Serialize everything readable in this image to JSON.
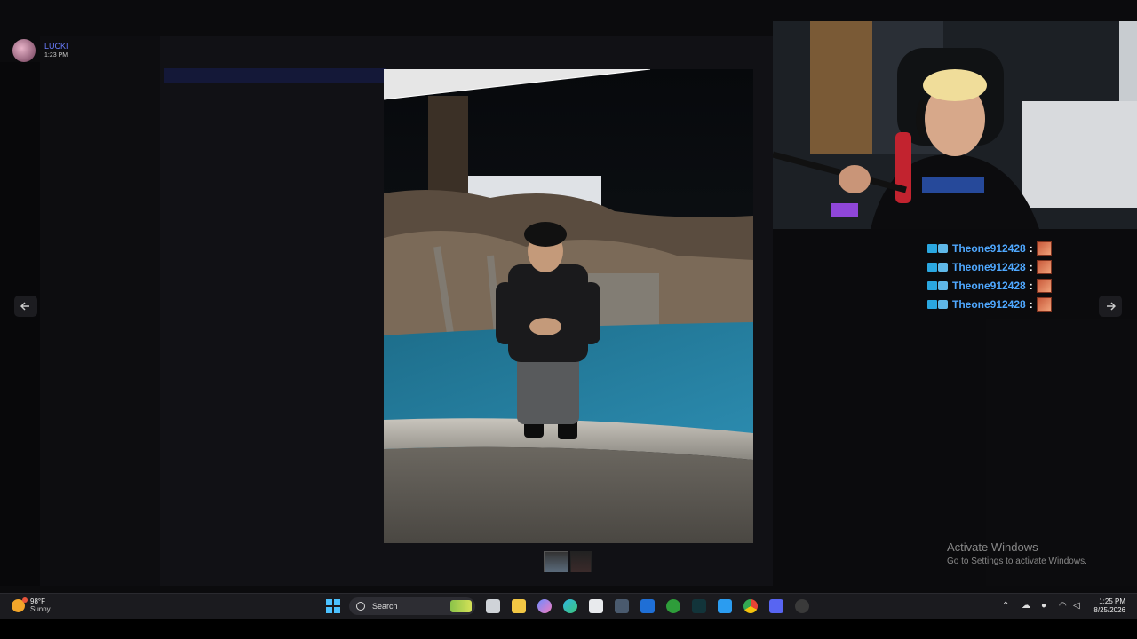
{
  "app": {
    "header": {
      "username": "LUCKI",
      "time": "1:23 PM"
    },
    "nav": {
      "prev_icon": "arrow-left-icon",
      "next_icon": "arrow-right-icon"
    }
  },
  "chat_overlay": {
    "messages": [
      {
        "user": "Theone912428",
        "separator": ":"
      },
      {
        "user": "Theone912428",
        "separator": ":"
      },
      {
        "user": "Theone912428",
        "separator": ":"
      },
      {
        "user": "Theone912428",
        "separator": ":"
      }
    ],
    "name_color": "#4fa8ff"
  },
  "watermark": {
    "title": "Activate Windows",
    "subtitle": "Go to Settings to activate Windows."
  },
  "taskbar": {
    "weather": {
      "temp": "98°F",
      "desc": "Sunny"
    },
    "search_label": "Search",
    "clock": {
      "time": "1:25 PM",
      "date": "8/25/2026"
    },
    "accent": "#4cc2ff"
  }
}
